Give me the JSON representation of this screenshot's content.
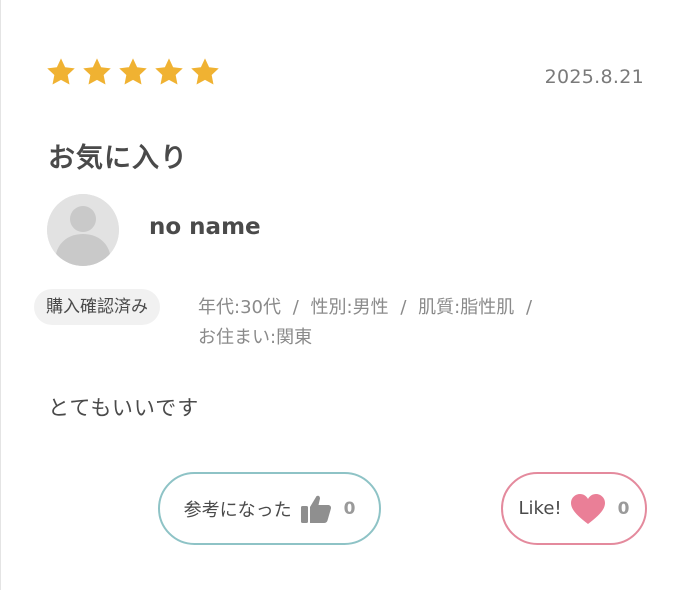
{
  "review": {
    "rating": 5,
    "max_rating": 5,
    "date": "2025.8.21",
    "title": "お気に入り",
    "body": "とてもいいです"
  },
  "user": {
    "name": "no name",
    "verified_label": "購入確認済み",
    "attributes": {
      "age": "年代:30代",
      "gender": "性別:男性",
      "skin": "肌質:脂性肌",
      "residence": "お住まい:関東"
    },
    "separator": "/"
  },
  "actions": {
    "helpful_label": "参考になった",
    "helpful_count": "0",
    "like_label": "Like!",
    "like_count": "0"
  },
  "colors": {
    "star": "#f0b232",
    "helpful_border": "#8ec3c6",
    "like_border": "#e48a9d",
    "heart": "#ea7f97",
    "thumb": "#8f8f8f"
  }
}
